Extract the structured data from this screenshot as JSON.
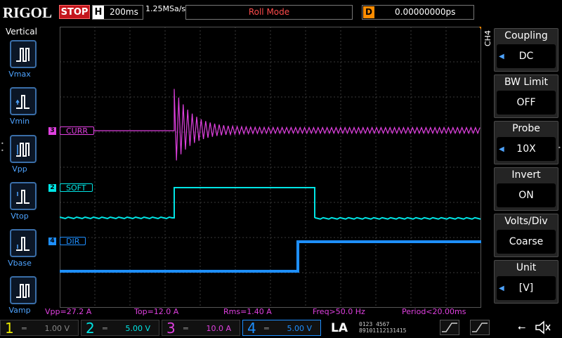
{
  "brand": "RIGOL",
  "run_state": "STOP",
  "timebase": {
    "label": "H",
    "value": "200ms",
    "sample_rate": "1.25MSa/s"
  },
  "mode": "Roll Mode",
  "delay": {
    "label": "D",
    "value": "0.00000000ps"
  },
  "left_menu": {
    "title": "Vertical",
    "items": [
      {
        "label": "Vmax",
        "icon": "vmax-icon"
      },
      {
        "label": "Vmin",
        "icon": "vmin-icon"
      },
      {
        "label": "Vpp",
        "icon": "vpp-icon"
      },
      {
        "label": "Vtop",
        "icon": "vtop-icon"
      },
      {
        "label": "Vbase",
        "icon": "vbase-icon"
      },
      {
        "label": "Vamp",
        "icon": "vamp-icon"
      }
    ]
  },
  "channels_on_screen": [
    {
      "num": "3",
      "name": "CURR",
      "color": "#e040e0"
    },
    {
      "num": "2",
      "name": "SOFT",
      "color": "#00e5e5"
    },
    {
      "num": "4",
      "name": "DIR",
      "color": "#1e8fff"
    }
  ],
  "right_panel": {
    "channel_tag": "CH4",
    "items": [
      {
        "title": "Coupling",
        "value": "DC"
      },
      {
        "title": "BW Limit",
        "value": "OFF"
      },
      {
        "title": "Probe",
        "value": "10X"
      },
      {
        "title": "Invert",
        "value": "ON"
      },
      {
        "title": "Volts/Div",
        "value": "Coarse"
      },
      {
        "title": "Unit",
        "value": "[V]"
      }
    ]
  },
  "measurements": [
    {
      "text": "Vpp=27.2 A"
    },
    {
      "text": "Top=12.0 A"
    },
    {
      "text": "Rms=1.40 A"
    },
    {
      "text": "Freq>50.0 Hz"
    },
    {
      "text": "Period<20.00ms"
    }
  ],
  "bottom_channels": [
    {
      "num": "1",
      "scale": "1.00 V",
      "color": "#e8e800"
    },
    {
      "num": "2",
      "scale": "5.00 V",
      "color": "#00e5e5"
    },
    {
      "num": "3",
      "scale": "10.0 A",
      "color": "#e040e0"
    },
    {
      "num": "4",
      "scale": "5.00 V",
      "color": "#1e8fff"
    }
  ],
  "la_label": "LA",
  "la_digits": {
    "row1": "0123 4567",
    "row2": "89101112131415"
  },
  "colors": {
    "grid": "#3a3a3a",
    "accent_blue": "#4ea3ff"
  }
}
